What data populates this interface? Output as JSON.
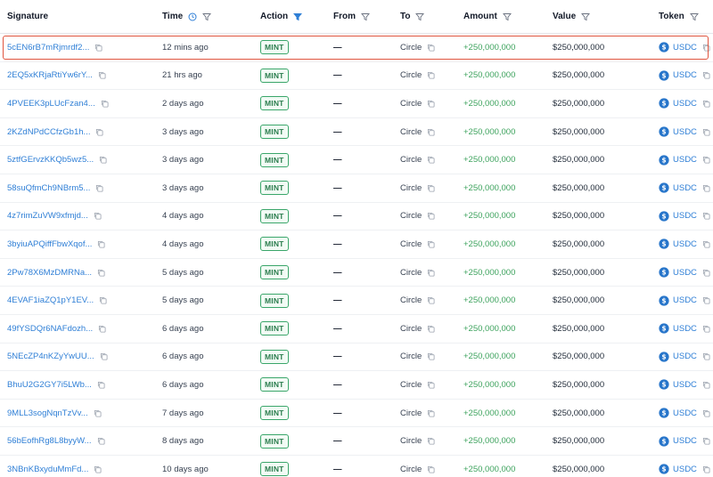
{
  "headers": {
    "signature": "Signature",
    "time": "Time",
    "action": "Action",
    "from": "From",
    "to": "To",
    "amount": "Amount",
    "value": "Value",
    "token": "Token"
  },
  "colors": {
    "link": "#2f7fd6",
    "amount": "#3ea35e",
    "badge": "#3aa66a",
    "highlight": "#e0553f",
    "filter_active": "#2f7fd6"
  },
  "rows": [
    {
      "signature": "5cEN6rB7mRjmrdf2...",
      "time": "12 mins ago",
      "action": "MINT",
      "from": "—",
      "to": "Circle",
      "amount": "+250,000,000",
      "value": "$250,000,000",
      "token": "USDC"
    },
    {
      "signature": "2EQ5xKRjaRtiYw6rY...",
      "time": "21 hrs ago",
      "action": "MINT",
      "from": "—",
      "to": "Circle",
      "amount": "+250,000,000",
      "value": "$250,000,000",
      "token": "USDC"
    },
    {
      "signature": "4PVEEK3pLUcFzan4...",
      "time": "2 days ago",
      "action": "MINT",
      "from": "—",
      "to": "Circle",
      "amount": "+250,000,000",
      "value": "$250,000,000",
      "token": "USDC"
    },
    {
      "signature": "2KZdNPdCCfzGb1h...",
      "time": "3 days ago",
      "action": "MINT",
      "from": "—",
      "to": "Circle",
      "amount": "+250,000,000",
      "value": "$250,000,000",
      "token": "USDC"
    },
    {
      "signature": "5ztfGErvzKKQb5wz5...",
      "time": "3 days ago",
      "action": "MINT",
      "from": "—",
      "to": "Circle",
      "amount": "+250,000,000",
      "value": "$250,000,000",
      "token": "USDC"
    },
    {
      "signature": "58suQfmCh9NBrm5...",
      "time": "3 days ago",
      "action": "MINT",
      "from": "—",
      "to": "Circle",
      "amount": "+250,000,000",
      "value": "$250,000,000",
      "token": "USDC"
    },
    {
      "signature": "4z7rimZuVW9xfmjd...",
      "time": "4 days ago",
      "action": "MINT",
      "from": "—",
      "to": "Circle",
      "amount": "+250,000,000",
      "value": "$250,000,000",
      "token": "USDC"
    },
    {
      "signature": "3byiuAPQiffFbwXqof...",
      "time": "4 days ago",
      "action": "MINT",
      "from": "—",
      "to": "Circle",
      "amount": "+250,000,000",
      "value": "$250,000,000",
      "token": "USDC"
    },
    {
      "signature": "2Pw78X6MzDMRNa...",
      "time": "5 days ago",
      "action": "MINT",
      "from": "—",
      "to": "Circle",
      "amount": "+250,000,000",
      "value": "$250,000,000",
      "token": "USDC"
    },
    {
      "signature": "4EVAF1iaZQ1pY1EV...",
      "time": "5 days ago",
      "action": "MINT",
      "from": "—",
      "to": "Circle",
      "amount": "+250,000,000",
      "value": "$250,000,000",
      "token": "USDC"
    },
    {
      "signature": "49fYSDQr6NAFdozh...",
      "time": "6 days ago",
      "action": "MINT",
      "from": "—",
      "to": "Circle",
      "amount": "+250,000,000",
      "value": "$250,000,000",
      "token": "USDC"
    },
    {
      "signature": "5NEcZP4nKZyYwUU...",
      "time": "6 days ago",
      "action": "MINT",
      "from": "—",
      "to": "Circle",
      "amount": "+250,000,000",
      "value": "$250,000,000",
      "token": "USDC"
    },
    {
      "signature": "BhuU2G2GY7i5LWb...",
      "time": "6 days ago",
      "action": "MINT",
      "from": "—",
      "to": "Circle",
      "amount": "+250,000,000",
      "value": "$250,000,000",
      "token": "USDC"
    },
    {
      "signature": "9MLL3sogNqnTzVv...",
      "time": "7 days ago",
      "action": "MINT",
      "from": "—",
      "to": "Circle",
      "amount": "+250,000,000",
      "value": "$250,000,000",
      "token": "USDC"
    },
    {
      "signature": "56bEofhRg8L8byyW...",
      "time": "8 days ago",
      "action": "MINT",
      "from": "—",
      "to": "Circle",
      "amount": "+250,000,000",
      "value": "$250,000,000",
      "token": "USDC"
    },
    {
      "signature": "3NBnKBxyduMmFd...",
      "time": "10 days ago",
      "action": "MINT",
      "from": "—",
      "to": "Circle",
      "amount": "+250,000,000",
      "value": "$250,000,000",
      "token": "USDC"
    }
  ]
}
